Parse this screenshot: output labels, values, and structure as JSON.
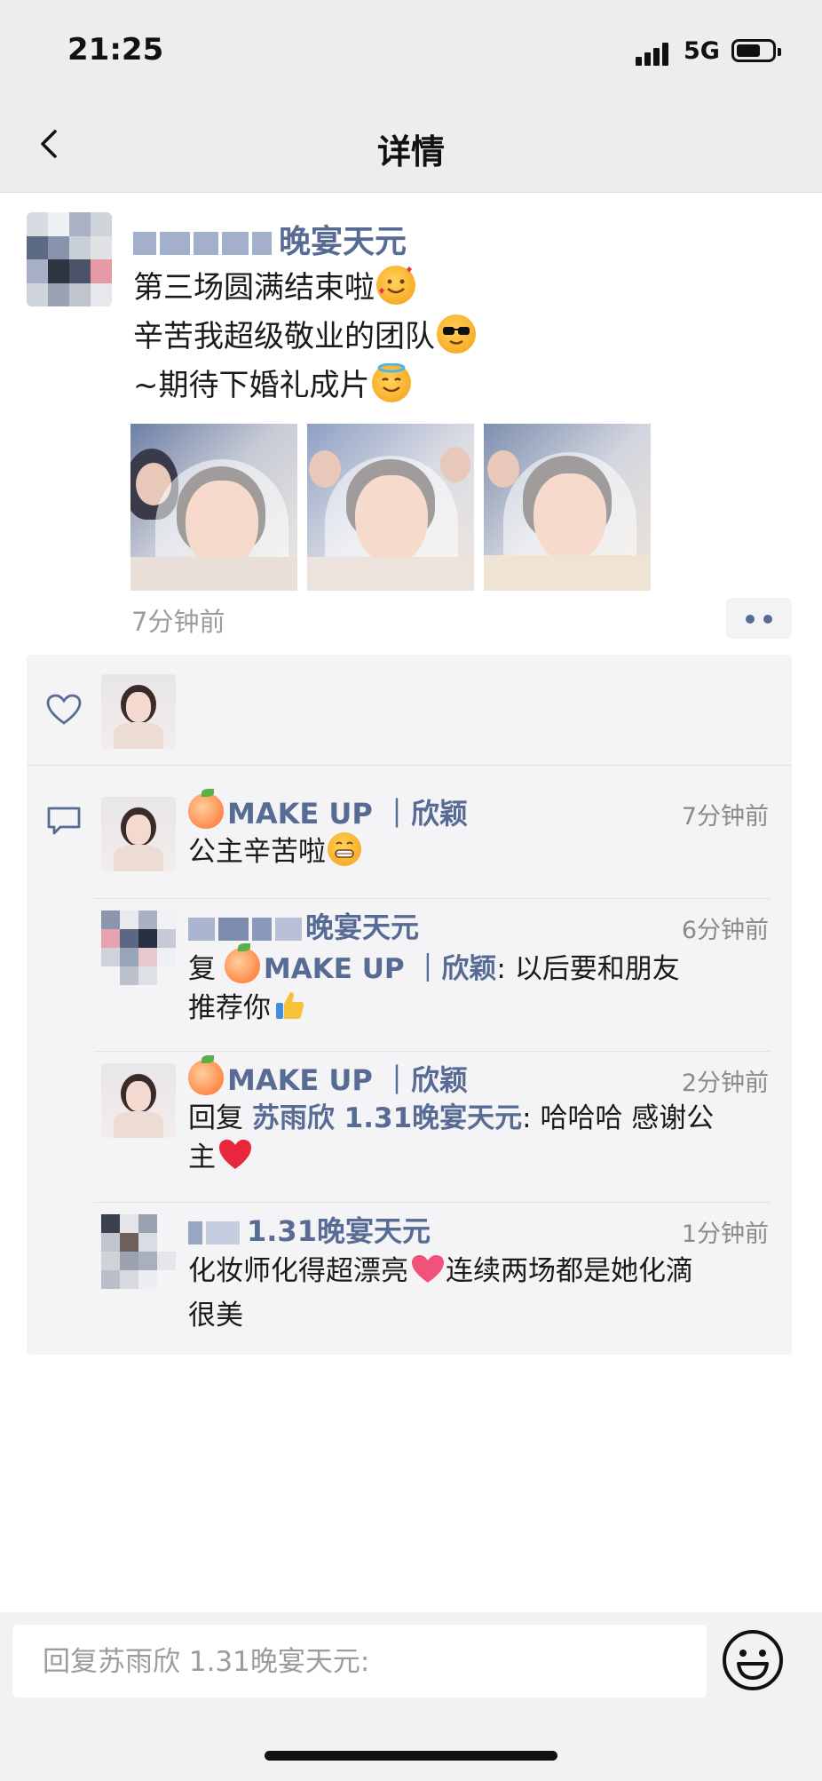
{
  "status": {
    "time": "21:25",
    "network": "5G"
  },
  "nav": {
    "title": "详情"
  },
  "post": {
    "author_suffix": "晚宴天元",
    "lines": [
      "第三场圆满结束啦",
      "辛苦我超级敬业的团队",
      "~期待下婚礼成片"
    ],
    "line_emojis": [
      "smiling-face-with-hearts-emoji",
      "sunglasses-emoji",
      "halo-face-emoji"
    ],
    "photo_count": 3,
    "time": "7分钟前"
  },
  "comments": [
    {
      "name": "MAKE UP ｜欣颖",
      "time": "7分钟前",
      "text": "公主辛苦啦"
    },
    {
      "name_suffix": "晚宴天元",
      "time": "6分钟前",
      "reply_prefix": "复 ",
      "reply_to": "MAKE UP ｜欣颖",
      "text_line1": ": 以后要和朋友",
      "text_line2": "推荐你"
    },
    {
      "name": "MAKE UP ｜欣颖",
      "time": "2分钟前",
      "reply_prefix": "回复 ",
      "reply_to": "苏雨欣 1.31晚宴天元",
      "text_line1": ": 哈哈哈 感谢公",
      "text_line2": "主"
    },
    {
      "name_suffix": "1.31晚宴天元",
      "time": "1分钟前",
      "text_line1a": "化妆师化得超漂亮",
      "text_line1b": "连续两场都是她化滴",
      "text_line2": "很美"
    }
  ],
  "input": {
    "placeholder": "回复苏雨欣 1.31晚宴天元:"
  },
  "colors": {
    "link": "#576b95",
    "panel": "#f4f4f6",
    "bar": "#ededed"
  }
}
